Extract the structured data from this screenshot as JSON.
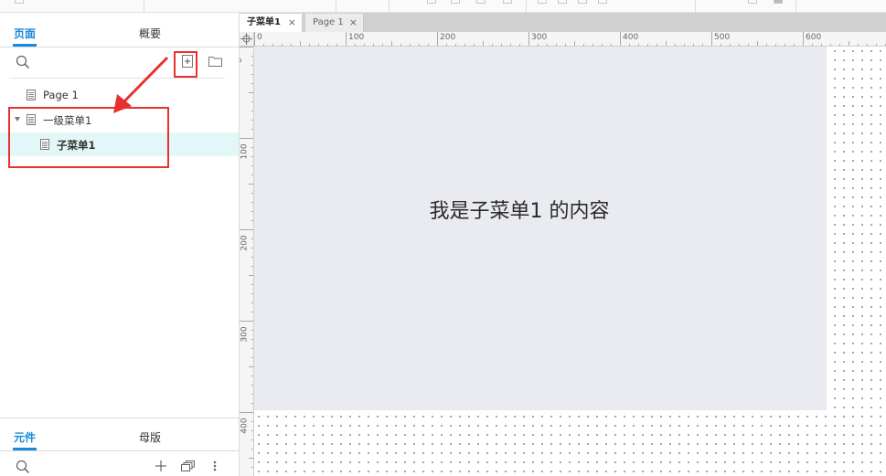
{
  "left_panel": {
    "tabs": {
      "pages": "页面",
      "outline": "概要"
    },
    "tree": [
      {
        "label": "Page 1"
      },
      {
        "label": "一级菜单1"
      },
      {
        "label": "子菜单1"
      }
    ],
    "bottom_tabs": {
      "widgets": "元件",
      "masters": "母版"
    }
  },
  "doc_tabs": [
    {
      "label": "子菜单1",
      "close": "×"
    },
    {
      "label": "Page 1",
      "close": "×"
    }
  ],
  "rulers": {
    "horizontal": [
      "0",
      "100",
      "200",
      "300",
      "400",
      "500",
      "600"
    ],
    "vertical": [
      "0",
      "100",
      "200",
      "300",
      "400"
    ]
  },
  "canvas": {
    "text": "我是子菜单1 的内容"
  },
  "colors": {
    "accent": "#1a8bd8",
    "selection": "#e3f7f8",
    "annotation": "#e8312f",
    "page_bg": "#e9ebf0"
  }
}
